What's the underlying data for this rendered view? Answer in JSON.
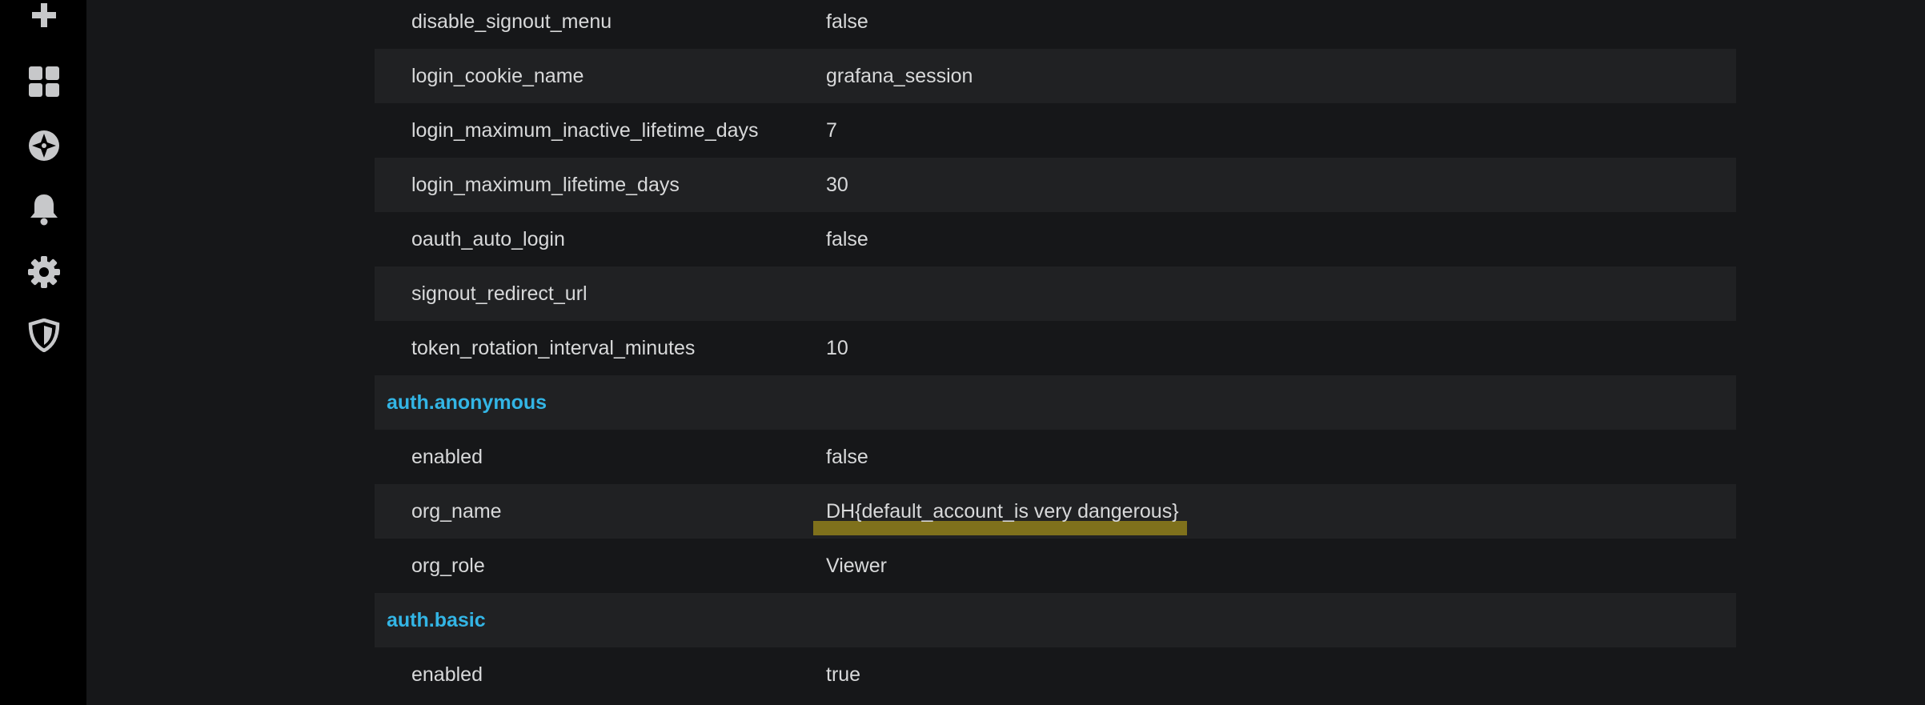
{
  "sidebar": {
    "icons": [
      "plus-icon",
      "dashboards-icon",
      "explore-icon",
      "alerting-icon",
      "configuration-icon",
      "server-admin-icon"
    ]
  },
  "rows": [
    {
      "type": "kv",
      "key": "disable_signout_menu",
      "value": "false"
    },
    {
      "type": "kv",
      "key": "login_cookie_name",
      "value": "grafana_session"
    },
    {
      "type": "kv",
      "key": "login_maximum_inactive_lifetime_days",
      "value": "7"
    },
    {
      "type": "kv",
      "key": "login_maximum_lifetime_days",
      "value": "30"
    },
    {
      "type": "kv",
      "key": "oauth_auto_login",
      "value": "false"
    },
    {
      "type": "kv",
      "key": "signout_redirect_url",
      "value": ""
    },
    {
      "type": "kv",
      "key": "token_rotation_interval_minutes",
      "value": "10"
    },
    {
      "type": "section",
      "title": "auth.anonymous"
    },
    {
      "type": "kv",
      "key": "enabled",
      "value": "false"
    },
    {
      "type": "kv",
      "key": "org_name",
      "value": "DH{default_account_is very dangerous}"
    },
    {
      "type": "kv",
      "key": "org_role",
      "value": "Viewer"
    },
    {
      "type": "section",
      "title": "auth.basic"
    },
    {
      "type": "kv",
      "key": "enabled",
      "value": "true"
    }
  ],
  "colors": {
    "section_title": "#33b5e5",
    "text": "#d8d9da",
    "highlight": "#8a7a1c"
  }
}
